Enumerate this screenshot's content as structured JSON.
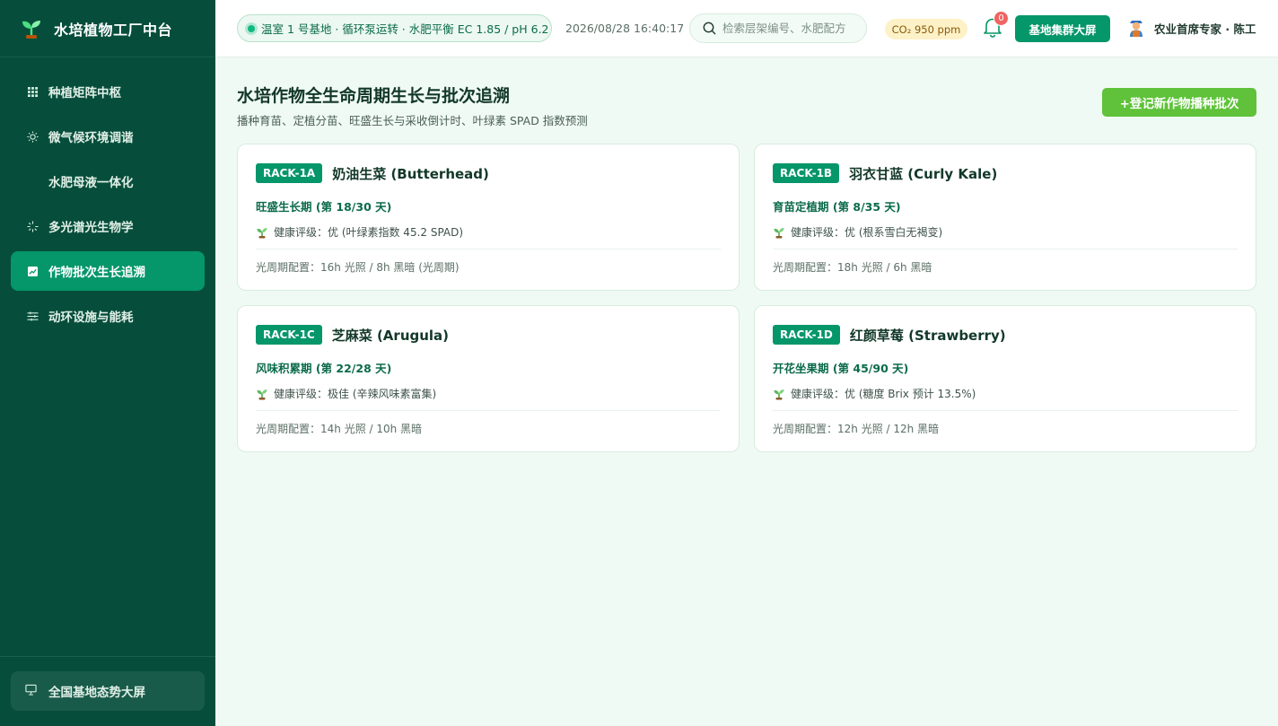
{
  "app": {
    "title": "水培植物工厂中台"
  },
  "sidebar": {
    "items": [
      {
        "label": "种植矩阵中枢",
        "icon": "grid-icon",
        "active": false
      },
      {
        "label": "微气候环境调谐",
        "icon": "sun-icon",
        "active": false
      },
      {
        "label": "水肥母液一体化",
        "icon": "",
        "active": false
      },
      {
        "label": "多光谱光生物学",
        "icon": "spectrum-icon",
        "active": false
      },
      {
        "label": "作物批次生长追溯",
        "icon": "chart-icon",
        "active": true
      },
      {
        "label": "动环设施与能耗",
        "icon": "sliders-icon",
        "active": false
      }
    ],
    "footer_label": "全国基地态势大屏"
  },
  "header": {
    "status": "温室 1 号基地 · 循环泵运转 · 水肥平衡 EC 1.85 / pH 6.2",
    "datetime": "2026/08/28 16:40:17",
    "search_placeholder": "检索层架编号、水肥配方",
    "co2": "CO₂ 950 ppm",
    "notification_count": "0",
    "bigscreen_label": "基地集群大屏",
    "user_label": "农业首席专家 · 陈工"
  },
  "main": {
    "title": "水培作物全生命周期生长与批次追溯",
    "subtitle": "播种育苗、定植分苗、旺盛生长与采收倒计时、叶绿素 SPAD 指数预测",
    "add_label": "+登记新作物播种批次",
    "cards": [
      {
        "rack": "RACK-1A",
        "name": "奶油生菜 (Butterhead)",
        "stage": "旺盛生长期 (第 18/30 天)",
        "health": "健康评级：优 (叶绿素指数 45.2 SPAD)",
        "photoperiod": "光周期配置：16h 光照 / 8h 黑暗 (光周期)"
      },
      {
        "rack": "RACK-1B",
        "name": "羽衣甘蓝 (Curly Kale)",
        "stage": "育苗定植期 (第 8/35 天)",
        "health": "健康评级：优 (根系雪白无褐变)",
        "photoperiod": "光周期配置：18h 光照 / 6h 黑暗"
      },
      {
        "rack": "RACK-1C",
        "name": "芝麻菜 (Arugula)",
        "stage": "风味积累期 (第 22/28 天)",
        "health": "健康评级：极佳 (辛辣风味素富集)",
        "photoperiod": "光周期配置：14h 光照 / 10h 黑暗"
      },
      {
        "rack": "RACK-1D",
        "name": "红颜草莓 (Strawberry)",
        "stage": "开花坐果期 (第 45/90 天)",
        "health": "健康评级：优 (糖度 Brix 预计 13.5%)",
        "photoperiod": "光周期配置：12h 光照 / 12h 黑暗"
      }
    ]
  },
  "colors": {
    "sidebar_bg": "#064e3b",
    "accent": "#059669",
    "add_button": "#5fc23a",
    "badge": "#ef6461"
  }
}
